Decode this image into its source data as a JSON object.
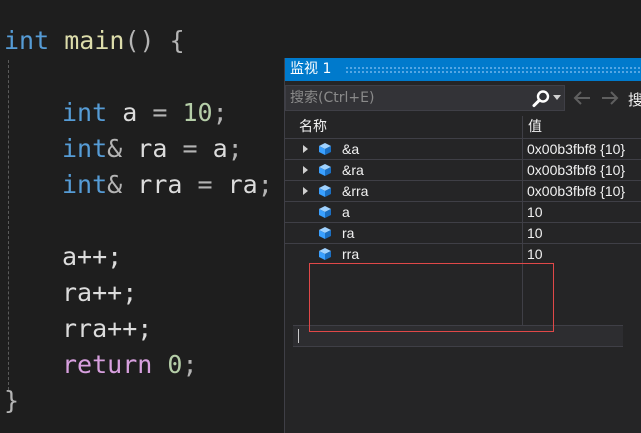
{
  "editor": {
    "lines": {
      "l1": {
        "kw": "int",
        "fn": "main",
        "rest": "() {"
      },
      "l2": {
        "kw": "int",
        "name": "a",
        "op": "=",
        "num": "10",
        "end": ";"
      },
      "l3": {
        "kw": "int",
        "amp": "&",
        "name": "ra",
        "op": "=",
        "rhs": "a",
        "end": ";"
      },
      "l4": {
        "kw": "int",
        "amp": "&",
        "name": "rra",
        "op": "=",
        "rhs": "ra",
        "end": ";"
      },
      "l5": {
        "text": "a++;"
      },
      "l6": {
        "text": "ra++;"
      },
      "l7": {
        "text": "rra++;"
      },
      "l8": {
        "kw": "return",
        "num": "0",
        "end": ";"
      },
      "l9": {
        "text": "}"
      }
    }
  },
  "watch": {
    "title": "监视 1",
    "search_placeholder": "搜索(Ctrl+E)",
    "search_depth_label": "搜",
    "columns": {
      "name": "名称",
      "value": "值"
    },
    "rows": [
      {
        "name": "&a",
        "value": "0x00b3fbf8 {10}",
        "expandable": true
      },
      {
        "name": "&ra",
        "value": "0x00b3fbf8 {10}",
        "expandable": true
      },
      {
        "name": "&rra",
        "value": "0x00b3fbf8 {10}",
        "expandable": true
      },
      {
        "name": "a",
        "value": "10",
        "expandable": false
      },
      {
        "name": "ra",
        "value": "10",
        "expandable": false
      },
      {
        "name": "rra",
        "value": "10",
        "expandable": false
      }
    ],
    "colors": {
      "title_bar": "#007acc",
      "highlight": "#e04848",
      "icon": "#3aa0ff"
    }
  }
}
